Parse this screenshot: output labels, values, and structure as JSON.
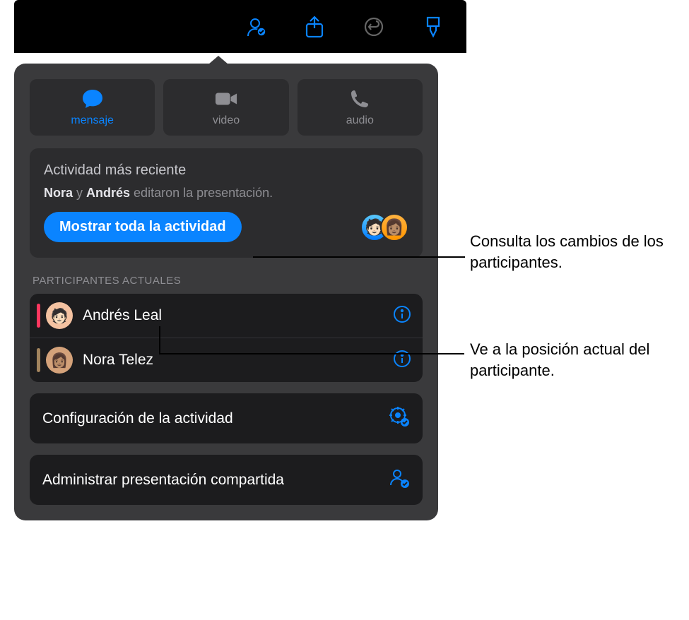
{
  "toolbar": {
    "icons": [
      "collaborate",
      "share",
      "undo",
      "format-brush"
    ]
  },
  "contact": {
    "message": "mensaje",
    "video": "video",
    "audio": "audio"
  },
  "activity": {
    "title": "Actividad más reciente",
    "person1": "Nora",
    "joiner": " y ",
    "person2": "Andrés",
    "rest": " editaron la presentación.",
    "show_all": "Mostrar toda la actividad"
  },
  "participants": {
    "heading": "PARTICIPANTES ACTUALES",
    "items": [
      {
        "name": "Andrés Leal",
        "color": "pink"
      },
      {
        "name": "Nora Telez",
        "color": "brown"
      }
    ]
  },
  "options": {
    "activity_settings": "Configuración de la actividad",
    "manage_shared": "Administrar presentación compartida"
  },
  "callouts": {
    "c1": "Consulta los cambios de los participantes.",
    "c2": "Ve a la posición actual del participante."
  }
}
